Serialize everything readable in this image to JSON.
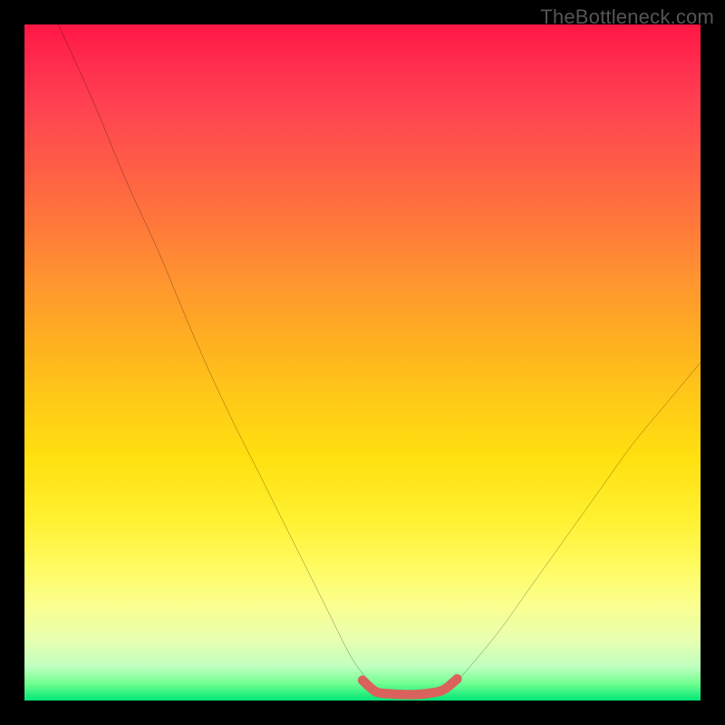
{
  "watermark": "TheBottleneck.com",
  "chart_data": {
    "type": "line",
    "title": "",
    "xlabel": "",
    "ylabel": "",
    "xlim": [
      0,
      100
    ],
    "ylim": [
      0,
      100
    ],
    "gradient_stops": [
      {
        "pos": 0,
        "color": "#ff1744"
      },
      {
        "pos": 6,
        "color": "#ff2d4f"
      },
      {
        "pos": 13,
        "color": "#ff4550"
      },
      {
        "pos": 22,
        "color": "#ff6045"
      },
      {
        "pos": 30,
        "color": "#ff7a3a"
      },
      {
        "pos": 38,
        "color": "#ff9530"
      },
      {
        "pos": 47,
        "color": "#ffb020"
      },
      {
        "pos": 55,
        "color": "#ffc818"
      },
      {
        "pos": 64,
        "color": "#ffe010"
      },
      {
        "pos": 73,
        "color": "#fff030"
      },
      {
        "pos": 80,
        "color": "#fffb60"
      },
      {
        "pos": 86,
        "color": "#fbff90"
      },
      {
        "pos": 91,
        "color": "#e8ffb0"
      },
      {
        "pos": 95,
        "color": "#c0ffc0"
      },
      {
        "pos": 97.5,
        "color": "#70ff90"
      },
      {
        "pos": 100,
        "color": "#00e676"
      }
    ],
    "series": [
      {
        "name": "black-curve",
        "color": "#000000",
        "x": [
          5,
          10,
          15,
          20,
          25,
          30,
          35,
          40,
          45,
          48,
          50,
          52,
          55,
          57,
          60,
          63,
          65,
          70,
          75,
          80,
          85,
          90,
          95,
          100
        ],
        "y": [
          100,
          89,
          77,
          66,
          54,
          43,
          33,
          23,
          13,
          7,
          4,
          2,
          1,
          1,
          1,
          2,
          4,
          10,
          17,
          24,
          31,
          38,
          44,
          50
        ]
      },
      {
        "name": "red-highlight",
        "color": "#d9625c",
        "x": [
          50,
          52,
          54,
          56,
          58,
          60,
          62,
          64
        ],
        "y": [
          3.0,
          1.3,
          1.0,
          0.9,
          0.9,
          1.1,
          1.6,
          3.2
        ]
      }
    ]
  }
}
